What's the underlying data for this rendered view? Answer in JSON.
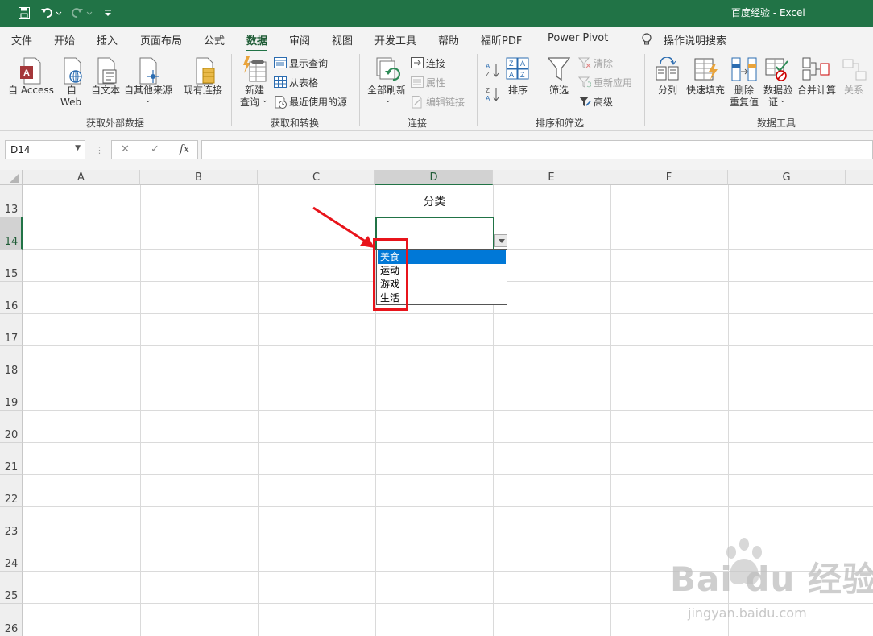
{
  "window": {
    "title": "百度经验  -  Excel",
    "quick_access": {
      "save": "save-icon",
      "undo": "undo-icon",
      "redo": "redo-icon",
      "customize": "customize-icon"
    }
  },
  "tabs": [
    {
      "label": "文件",
      "active": false
    },
    {
      "label": "开始",
      "active": false
    },
    {
      "label": "插入",
      "active": false
    },
    {
      "label": "页面布局",
      "active": false
    },
    {
      "label": "公式",
      "active": false
    },
    {
      "label": "数据",
      "active": true
    },
    {
      "label": "审阅",
      "active": false
    },
    {
      "label": "视图",
      "active": false
    },
    {
      "label": "开发工具",
      "active": false
    },
    {
      "label": "帮助",
      "active": false
    },
    {
      "label": "福昕PDF",
      "active": false
    },
    {
      "label": "Power Pivot",
      "active": false
    }
  ],
  "tell_me": "操作说明搜索",
  "ribbon": {
    "get_external": {
      "group": "获取外部数据",
      "access": "自 Access",
      "web_1": "自",
      "web_2": "Web",
      "text": "自文本",
      "other": "自其他来源",
      "existing": "现有连接"
    },
    "get_transform": {
      "group": "获取和转换",
      "new_query_1": "新建",
      "new_query_2": "查询",
      "show_queries": "显示查询",
      "from_table": "从表格",
      "recent_sources": "最近使用的源"
    },
    "connections": {
      "group": "连接",
      "refresh_all": "全部刷新",
      "connections": "连接",
      "properties": "属性",
      "edit_links": "编辑链接"
    },
    "sort_filter": {
      "group": "排序和筛选",
      "sort": "排序",
      "filter": "筛选",
      "clear": "清除",
      "reapply": "重新应用",
      "advanced": "高级"
    },
    "data_tools": {
      "group": "数据工具",
      "split": "分列",
      "flash_fill": "快速填充",
      "remove_dup_1": "删除",
      "remove_dup_2": "重复值",
      "validation_1": "数据验",
      "validation_2": "证",
      "consolidate": "合并计算",
      "relationships": "关系"
    }
  },
  "formula_bar": {
    "name_box": "D14",
    "cancel": "✕",
    "enter": "✓",
    "fx": "fx",
    "formula": ""
  },
  "sheet": {
    "columns": [
      "A",
      "B",
      "C",
      "D",
      "E",
      "F",
      "G"
    ],
    "selected_column": "D",
    "rows": [
      "13",
      "14",
      "15",
      "16",
      "17",
      "18",
      "19",
      "20",
      "21",
      "22",
      "23",
      "24",
      "25",
      "26"
    ],
    "selected_row": "14",
    "cells": {
      "D13": "分类"
    }
  },
  "dropdown": {
    "options": [
      "美食",
      "运动",
      "游戏",
      "生活"
    ],
    "selected_index": 0
  },
  "annotation": {
    "color": "#e8141b"
  },
  "watermark": {
    "logo": "Bai du 经验",
    "url": "jingyan.baidu.com"
  },
  "colors": {
    "accent": "#217346",
    "selection": "#0078d7"
  }
}
